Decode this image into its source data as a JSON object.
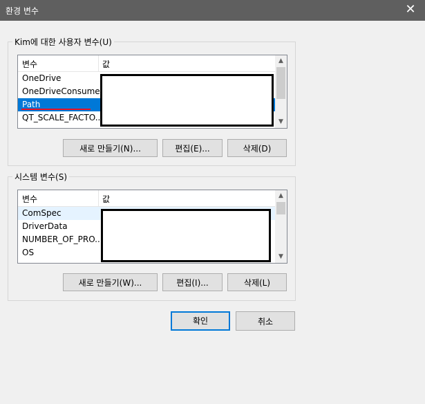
{
  "window": {
    "title": "환경 변수",
    "close_glyph": "✕"
  },
  "user_vars": {
    "legend": "Kim에 대한 사용자 변수(U)",
    "col_name": "변수",
    "col_value": "값",
    "rows": [
      {
        "name": "OneDrive"
      },
      {
        "name": "OneDriveConsumer"
      },
      {
        "name": "Path"
      },
      {
        "name": "QT_SCALE_FACTO..."
      }
    ],
    "new_button": "새로 만들기(N)...",
    "edit_button": "편집(E)...",
    "delete_button": "삭제(D)"
  },
  "system_vars": {
    "legend": "시스템 변수(S)",
    "col_name": "변수",
    "col_value": "값",
    "rows": [
      {
        "name": "ComSpec"
      },
      {
        "name": "DriverData"
      },
      {
        "name": "NUMBER_OF_PRO..."
      },
      {
        "name": "OS"
      }
    ],
    "new_button": "새로 만들기(W)...",
    "edit_button": "편집(I)...",
    "delete_button": "삭제(L)"
  },
  "footer": {
    "ok_button": "확인",
    "cancel_button": "취소"
  },
  "icons": {
    "scroll_up": "▲",
    "scroll_down": "▼"
  }
}
